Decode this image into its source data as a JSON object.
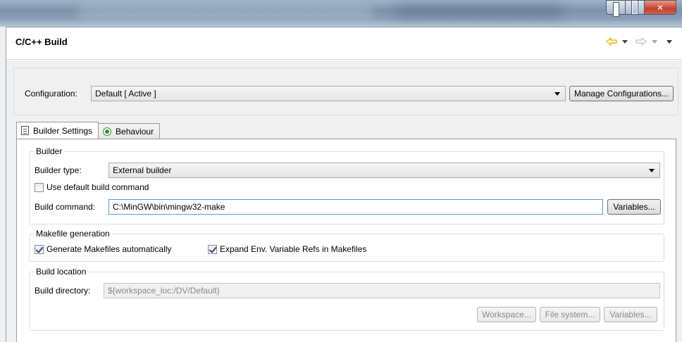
{
  "page": {
    "title": "C/C++ Build"
  },
  "configuration": {
    "label": "Configuration:",
    "value": "Default  [ Active ]",
    "manage_button": "Manage Configurations..."
  },
  "tabs": [
    {
      "label": "Builder Settings",
      "icon": "list-icon",
      "active": true
    },
    {
      "label": "Behaviour",
      "icon": "radio-icon",
      "active": false
    }
  ],
  "builder": {
    "group_title": "Builder",
    "type_label": "Builder type:",
    "type_value": "External builder",
    "use_default_label": "Use default build command",
    "use_default_checked": false,
    "command_label": "Build command:",
    "command_value": "C:\\MinGW\\bin\\mingw32-make",
    "variables_button": "Variables..."
  },
  "makefile": {
    "group_title": "Makefile generation",
    "generate_label": "Generate Makefiles automatically",
    "generate_checked": true,
    "expand_label": "Expand Env. Variable Refs in Makefiles",
    "expand_checked": true
  },
  "location": {
    "group_title": "Build location",
    "dir_label": "Build directory:",
    "dir_value": "${workspace_loc:/DV/Default}",
    "workspace_button": "Workspace...",
    "filesystem_button": "File system...",
    "variables_button": "Variables..."
  },
  "colors": {
    "nav_arrow_active": "#f0b400",
    "nav_arrow_inactive": "#c9c9c9"
  }
}
